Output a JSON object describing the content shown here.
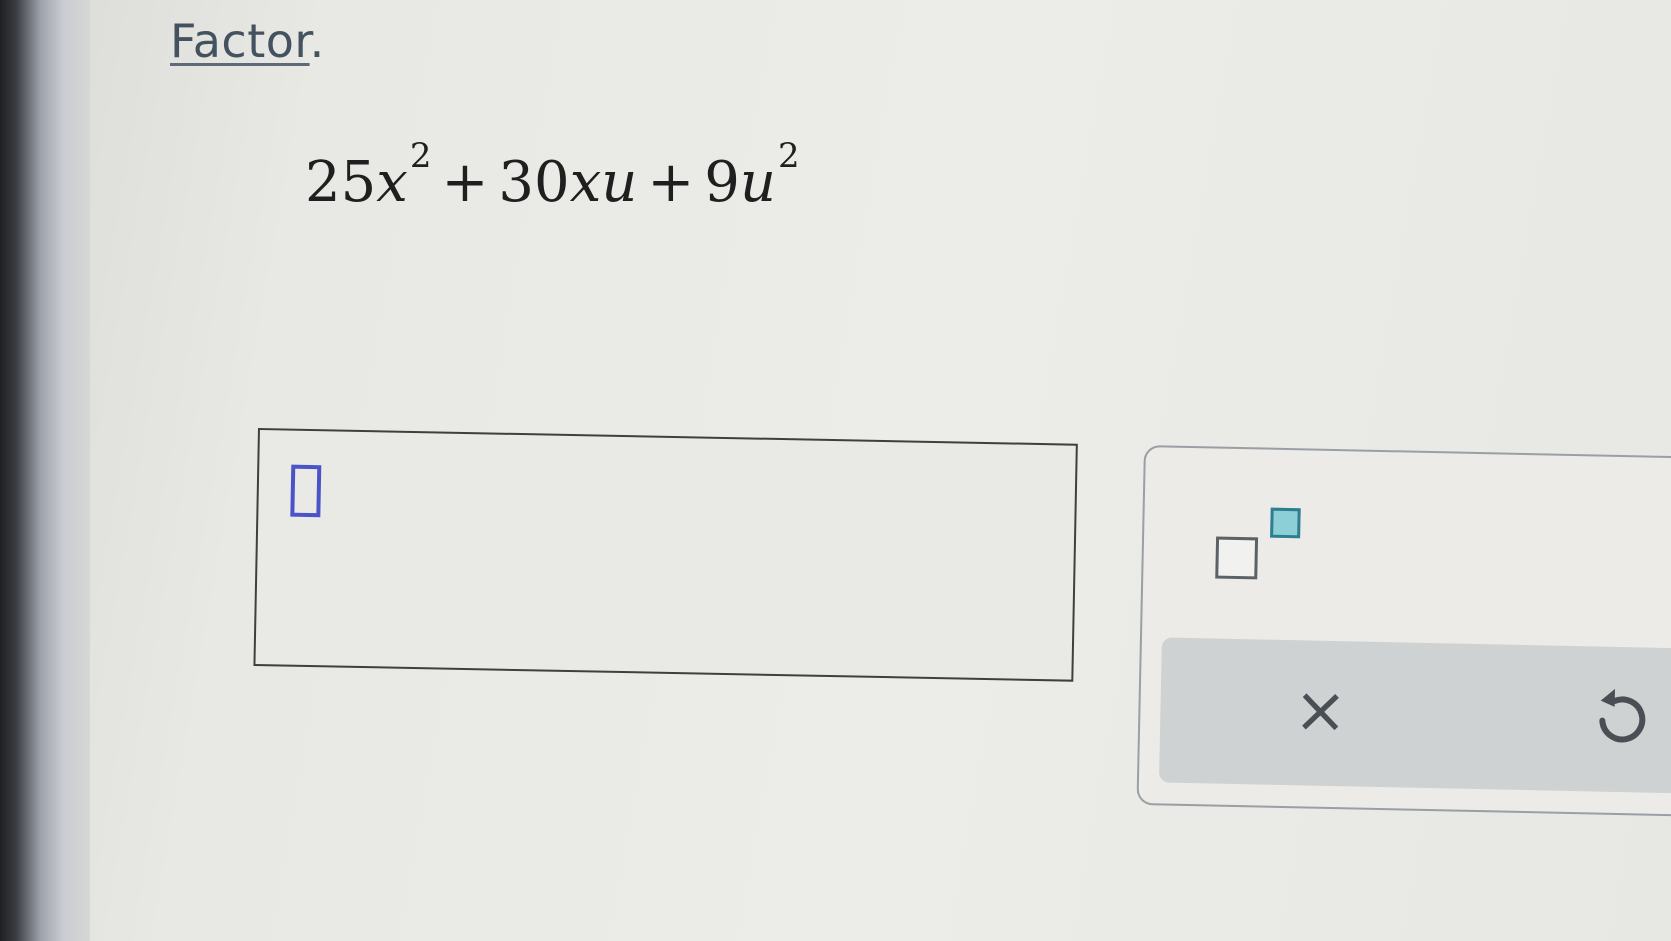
{
  "prompt": {
    "word": "Factor",
    "punctuation": "."
  },
  "expression": {
    "term1_coef": "25",
    "term1_var": "x",
    "term1_exp": "2",
    "op1": "+",
    "term2_coef": "30",
    "term2_var": "xu",
    "op2": "+",
    "term3_coef": "9",
    "term3_var": "u",
    "term3_exp": "2"
  },
  "toolbar": {
    "exponent_icon": "exponent-template-icon",
    "clear_icon": "close-icon",
    "clear_label": "×",
    "undo_icon": "undo-icon"
  },
  "colors": {
    "cursor": "#4a54c8",
    "exponent_accent": "#8ccfd6",
    "action_bar": "#cfd2d2"
  }
}
